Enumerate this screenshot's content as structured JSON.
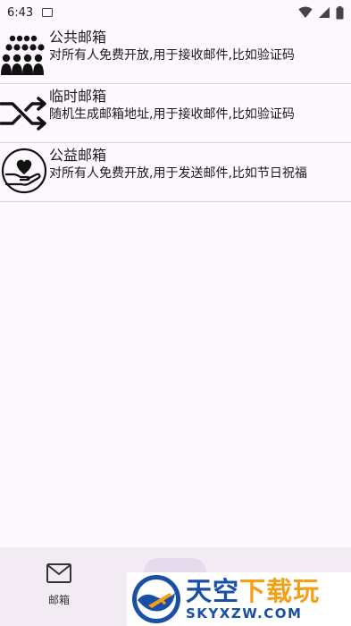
{
  "status_bar": {
    "time": "6:43"
  },
  "mailboxes": [
    {
      "title": "公共邮箱",
      "description": "对所有人免费开放,用于接收邮件,比如验证码",
      "icon": "people-group-icon"
    },
    {
      "title": "临时邮箱",
      "description": "随机生成邮箱地址,用于接收邮件,比如验证码",
      "icon": "shuffle-icon"
    },
    {
      "title": "公益邮箱",
      "description": "对所有人免费开放,用于发送邮件,比如节日祝福",
      "icon": "heart-hand-icon"
    }
  ],
  "bottom_nav": {
    "items": [
      {
        "label": "邮箱",
        "icon": "mail-icon"
      }
    ]
  },
  "watermark": {
    "chars": [
      "天",
      "空",
      "下",
      "载",
      "玩"
    ],
    "domain": "SKYXZW.COM"
  }
}
